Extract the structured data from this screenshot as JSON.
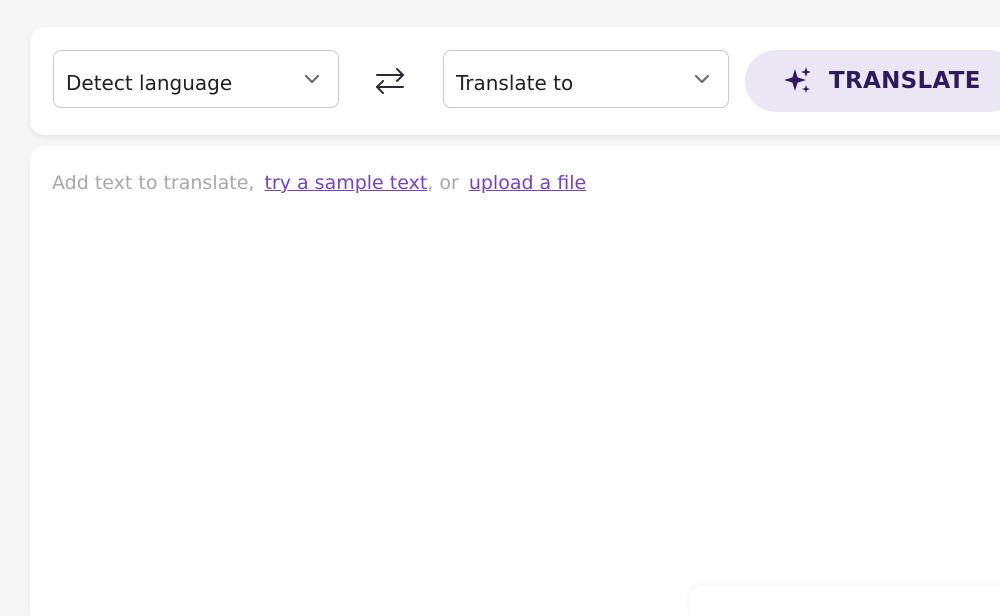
{
  "toolbar": {
    "source_select": {
      "value": "Detect language"
    },
    "target_select": {
      "value": "Translate to"
    },
    "swap_icon": "swap-arrows-icon",
    "translate_button": {
      "label": "TRANSLATE",
      "icon": "sparkle-icon"
    }
  },
  "editor": {
    "hint_prefix": "Add text to translate,",
    "sample_link": "try a sample text",
    "hint_middle": ", or",
    "upload_link": "upload a file"
  },
  "colors": {
    "accent": "#7b3fc4",
    "button_bg": "#ebe6f3",
    "button_text": "#2e1a5e",
    "hint_text": "#a7a7ad"
  }
}
